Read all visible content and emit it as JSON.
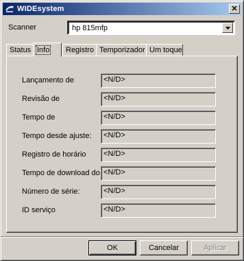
{
  "window": {
    "title": "WIDEsystem",
    "close_glyph": "✕"
  },
  "scanner": {
    "label": "Scanner",
    "value": "hp 815mfp"
  },
  "tabs": [
    {
      "label": "Status"
    },
    {
      "label": "Info",
      "active": true
    },
    {
      "label": "Registro"
    },
    {
      "label": "Temporizador"
    },
    {
      "label": "Um toque"
    }
  ],
  "fields": [
    {
      "label": "Lançamento de",
      "value": "<N/D>"
    },
    {
      "label": "Revisão de",
      "value": "<N/D>"
    },
    {
      "label": "Tempo de",
      "value": "<N/D>"
    },
    {
      "label": "Tempo desde ajuste:",
      "value": "<N/D>"
    },
    {
      "label": "Registro de horário",
      "value": "<N/D>"
    },
    {
      "label": "Tempo de download do",
      "value": "<N/D>"
    },
    {
      "label": "Número de série:",
      "value": "<N/D>"
    },
    {
      "label": "ID serviço",
      "value": "<N/D>"
    }
  ],
  "buttons": {
    "ok": "OK",
    "cancel": "Cancelar",
    "apply": "Aplicar"
  },
  "icons": {
    "app": "scanner-app-icon",
    "dropdown": "chevron-down-icon",
    "close": "close-icon"
  }
}
